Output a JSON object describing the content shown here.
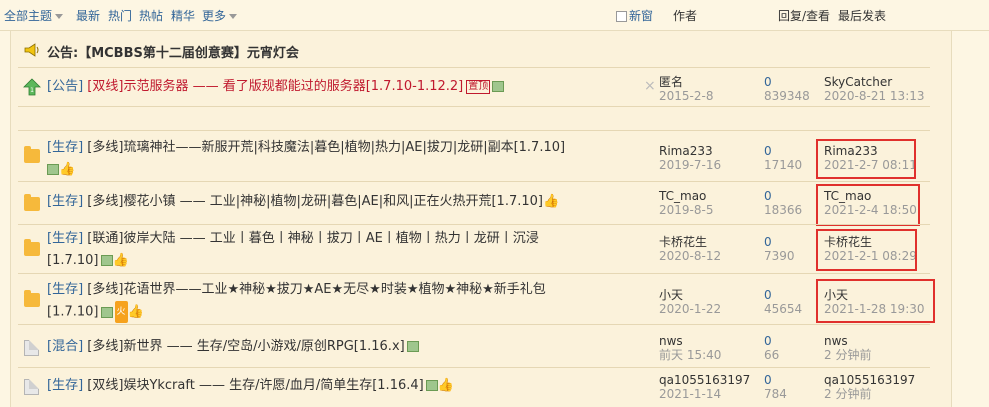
{
  "topbar": {
    "all_topics": "全部主题",
    "latest": "最新",
    "hot": "热门",
    "hot_posts": "热帖",
    "digest": "精华",
    "more": "更多",
    "new_window": "新窗",
    "author": "作者",
    "reply_view": "回复/查看",
    "last_post": "最后发表"
  },
  "notice": {
    "text": "公告:【MCBBS第十二届创意赛】元宵灯会"
  },
  "pinned": {
    "category": "[公告]",
    "title": "[双线]示范服务器 —— 看了版规都能过的服务器[1.7.10-1.12.2]",
    "badge": "置顶",
    "close": "×",
    "author": "匿名",
    "date": "2015-2-8",
    "replies": "0",
    "views": "839348",
    "last_user": "SkyCatcher",
    "last_time": "2020-8-21 13:13"
  },
  "threads": [
    {
      "category": "[生存]",
      "title": "[多线]琉璃神社——新服开荒|科技魔法|暮色|植物|热力|AE|拔刀|龙研|副本[1.7.10]",
      "author": "Rima233",
      "date": "2019-7-16",
      "replies": "0",
      "views": "17140",
      "last_user": "Rima233",
      "last_time": "2021-2-7 08:11"
    },
    {
      "category": "[生存]",
      "title": "[多线]樱花小镇 —— 工业|神秘|植物|龙研|暮色|AE|和风|正在火热开荒[1.7.10]",
      "author": "TC_mao",
      "date": "2019-8-5",
      "replies": "0",
      "views": "18366",
      "last_user": "TC_mao",
      "last_time": "2021-2-4 18:50"
    },
    {
      "category": "[生存]",
      "title": "[联通]彼岸大陆 —— 工业丨暮色丨神秘丨拔刀丨AE丨植物丨热力丨龙研丨沉浸",
      "title2": "[1.7.10]",
      "author": "卡桥花生",
      "date": "2020-8-12",
      "replies": "0",
      "views": "7390",
      "last_user": "卡桥花生",
      "last_time": "2021-2-1 08:29"
    },
    {
      "category": "[生存]",
      "title": "[多线]花语世界——工业★神秘★拔刀★AE★无尽★时装★植物★神秘★新手礼包",
      "title2": "[1.7.10]",
      "hot_badge": "火",
      "author": "小天",
      "date": "2020-1-22",
      "replies": "0",
      "views": "45654",
      "last_user": "小天",
      "last_time": "2021-1-28 19:30"
    },
    {
      "category": "[混合]",
      "title": "[多线]新世界 —— 生存/空岛/小游戏/原创RPG[1.16.x]",
      "author": "nws",
      "date": "前天 15:40",
      "replies": "0",
      "views": "66",
      "last_user": "nws",
      "last_time": "2 分钟前"
    },
    {
      "category": "[生存]",
      "title": "[双线]娱块Ykcraft —— 生存/许愿/血月/简单生存[1.16.4]",
      "author": "qa1055163197",
      "date": "2021-1-14",
      "replies": "0",
      "views": "784",
      "last_user": "qa1055163197",
      "last_time": "2 分钟前"
    }
  ]
}
